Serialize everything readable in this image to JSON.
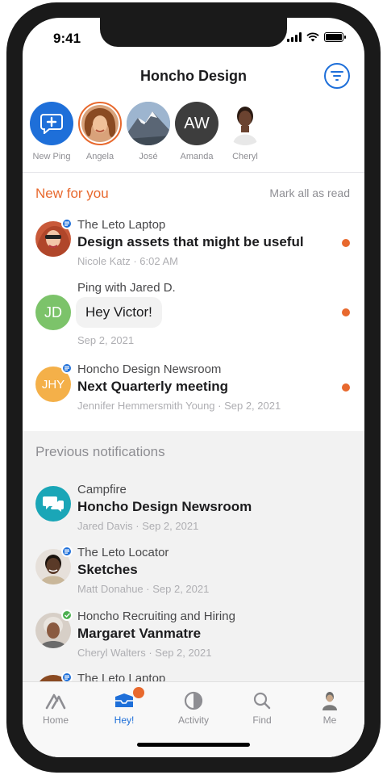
{
  "status": {
    "time": "9:41"
  },
  "header": {
    "title": "Honcho Design"
  },
  "stories": [
    {
      "label": "New Ping"
    },
    {
      "label": "Angela"
    },
    {
      "label": "José"
    },
    {
      "label": "Amanda",
      "initials": "AW"
    },
    {
      "label": "Cheryl"
    }
  ],
  "new_section": {
    "heading": "New for you",
    "mark_all": "Mark all as read",
    "items": [
      {
        "context": "The Leto Laptop",
        "title": "Design assets that might be useful",
        "meta": "Nicole Katz · 6:02 AM"
      },
      {
        "context": "Ping with Jared D.",
        "initials": "JD",
        "message": "Hey Victor!",
        "meta": "Sep 2, 2021"
      },
      {
        "context": "Honcho Design Newsroom",
        "initials": "JHY",
        "title": "Next Quarterly meeting",
        "meta": "Jennifer Hemmersmith Young · Sep 2, 2021"
      }
    ]
  },
  "prev_section": {
    "heading": "Previous notifications",
    "items": [
      {
        "context": "Campfire",
        "title": "Honcho Design Newsroom",
        "meta": "Jared Davis · Sep 2, 2021"
      },
      {
        "context": "The Leto Locator",
        "title": "Sketches",
        "meta": "Matt Donahue · Sep 2, 2021"
      },
      {
        "context": "Honcho Recruiting and Hiring",
        "title": "Margaret Vanmatre",
        "meta": "Cheryl Walters · Sep 2, 2021"
      },
      {
        "context": "The Leto Laptop"
      }
    ]
  },
  "tabs": [
    {
      "label": "Home",
      "icon": "home-icon"
    },
    {
      "label": "Hey!",
      "icon": "hey-inbox-icon"
    },
    {
      "label": "Activity",
      "icon": "activity-icon"
    },
    {
      "label": "Find",
      "icon": "search-icon"
    },
    {
      "label": "Me",
      "icon": "profile-icon"
    }
  ],
  "colors": {
    "accent_blue": "#1e6fd9",
    "accent_orange": "#e8692e",
    "teal": "#1aa6b7",
    "green": "#7cc36a",
    "amber": "#f4b049"
  }
}
